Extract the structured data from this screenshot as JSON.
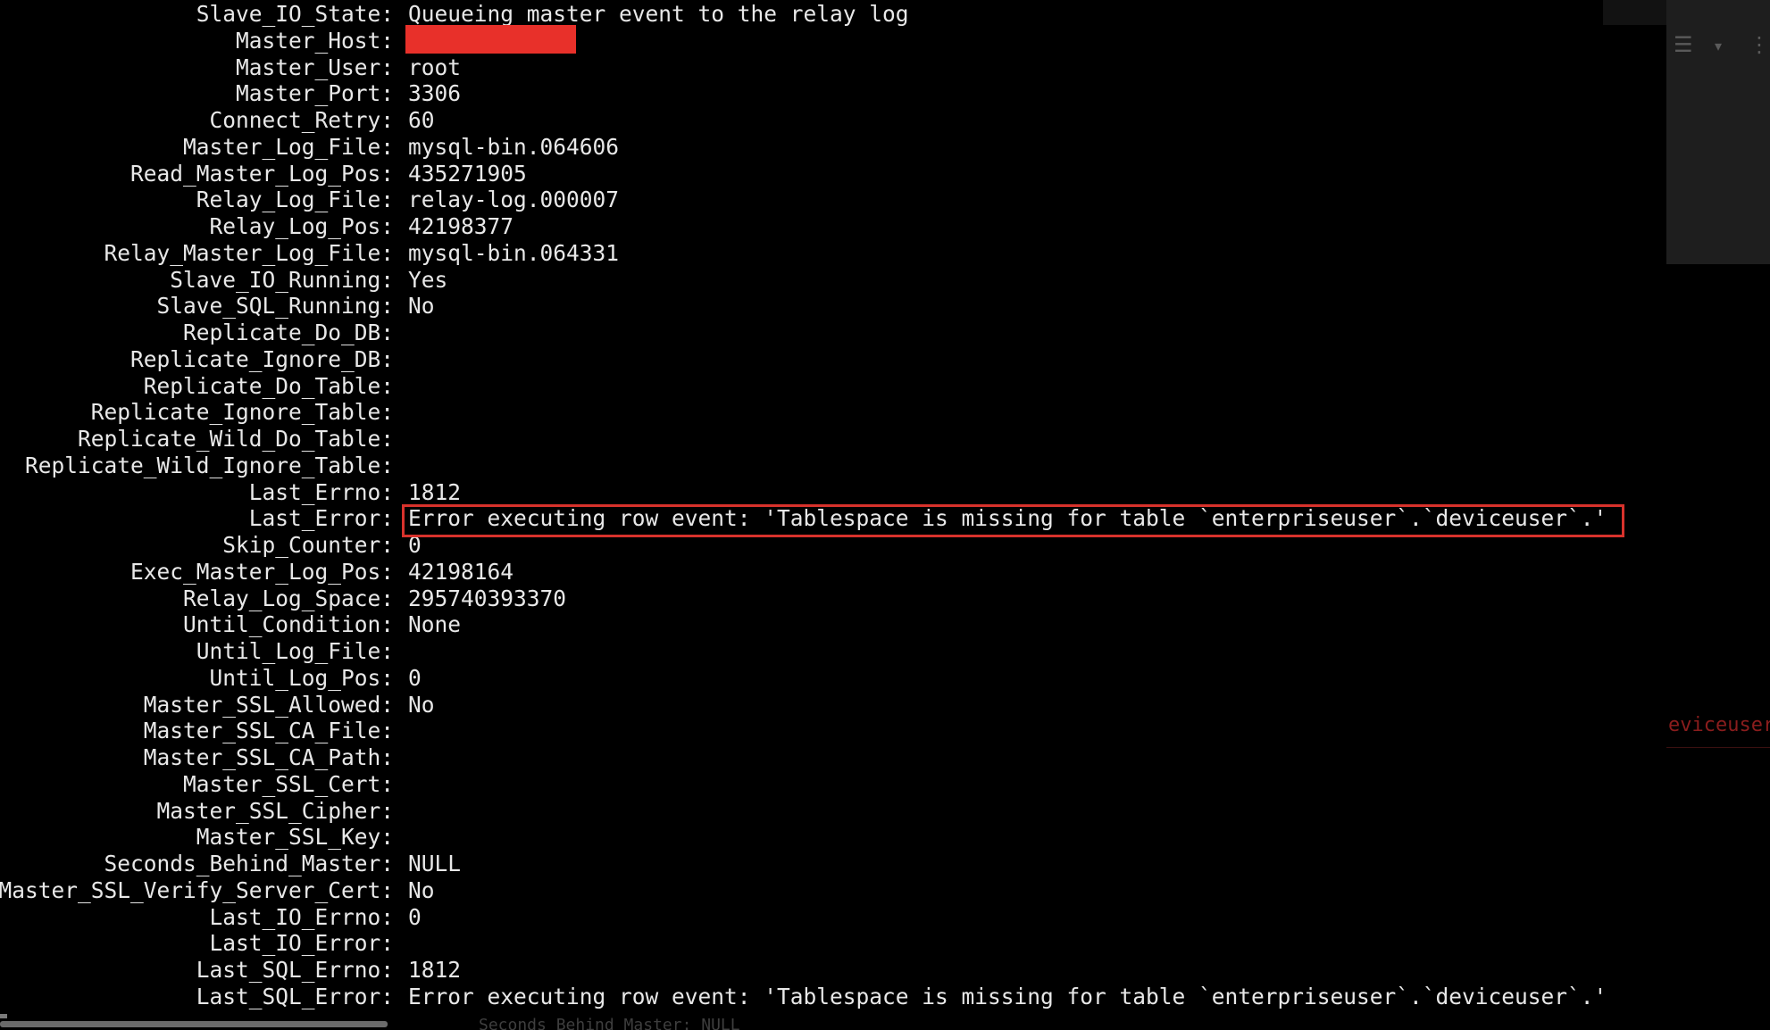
{
  "terminal": {
    "rows": [
      {
        "key": "Slave_IO_State:",
        "value": "Queueing master event to the relay log"
      },
      {
        "key": "Master_Host:",
        "value": ""
      },
      {
        "key": "Master_User:",
        "value": "root"
      },
      {
        "key": "Master_Port:",
        "value": "3306"
      },
      {
        "key": "Connect_Retry:",
        "value": "60"
      },
      {
        "key": "Master_Log_File:",
        "value": "mysql-bin.064606"
      },
      {
        "key": "Read_Master_Log_Pos:",
        "value": "435271905"
      },
      {
        "key": "Relay_Log_File:",
        "value": "relay-log.000007"
      },
      {
        "key": "Relay_Log_Pos:",
        "value": "42198377"
      },
      {
        "key": "Relay_Master_Log_File:",
        "value": "mysql-bin.064331"
      },
      {
        "key": "Slave_IO_Running:",
        "value": "Yes"
      },
      {
        "key": "Slave_SQL_Running:",
        "value": "No"
      },
      {
        "key": "Replicate_Do_DB:",
        "value": ""
      },
      {
        "key": "Replicate_Ignore_DB:",
        "value": ""
      },
      {
        "key": "Replicate_Do_Table:",
        "value": ""
      },
      {
        "key": "Replicate_Ignore_Table:",
        "value": ""
      },
      {
        "key": "Replicate_Wild_Do_Table:",
        "value": ""
      },
      {
        "key": "Replicate_Wild_Ignore_Table:",
        "value": ""
      },
      {
        "key": "Last_Errno:",
        "value": "1812"
      },
      {
        "key": "Last_Error:",
        "value": "Error executing row event: 'Tablespace is missing for table `enterpriseuser`.`deviceuser`.'"
      },
      {
        "key": "Skip_Counter:",
        "value": "0"
      },
      {
        "key": "Exec_Master_Log_Pos:",
        "value": "42198164"
      },
      {
        "key": "Relay_Log_Space:",
        "value": "295740393370"
      },
      {
        "key": "Until_Condition:",
        "value": "None"
      },
      {
        "key": "Until_Log_File:",
        "value": ""
      },
      {
        "key": "Until_Log_Pos:",
        "value": "0"
      },
      {
        "key": "Master_SSL_Allowed:",
        "value": "No"
      },
      {
        "key": "Master_SSL_CA_File:",
        "value": ""
      },
      {
        "key": "Master_SSL_CA_Path:",
        "value": ""
      },
      {
        "key": "Master_SSL_Cert:",
        "value": ""
      },
      {
        "key": "Master_SSL_Cipher:",
        "value": ""
      },
      {
        "key": "Master_SSL_Key:",
        "value": ""
      },
      {
        "key": "Seconds_Behind_Master:",
        "value": "NULL"
      },
      {
        "key": "Master_SSL_Verify_Server_Cert:",
        "value": "No"
      },
      {
        "key": "Last_IO_Errno:",
        "value": "0"
      },
      {
        "key": "Last_IO_Error:",
        "value": ""
      },
      {
        "key": "Last_SQL_Errno:",
        "value": "1812"
      },
      {
        "key": "Last_SQL_Error:",
        "value": "Error executing row event: 'Tablespace is missing for table `enterpriseuser`.`deviceuser`.'"
      }
    ],
    "echo_text": "Seconds_Behind_Master: NULL"
  },
  "side_panel": {
    "ghost_text": "eviceuser",
    "icons": [
      "collapse-icon",
      "list-icon",
      "chevron-down-icon",
      "indent-icon"
    ]
  },
  "colors": {
    "background": "#000000",
    "text": "#e8e8e8",
    "redaction": "#e8302a",
    "highlight_border": "#d8322c",
    "panel": "#1e1e1e"
  }
}
